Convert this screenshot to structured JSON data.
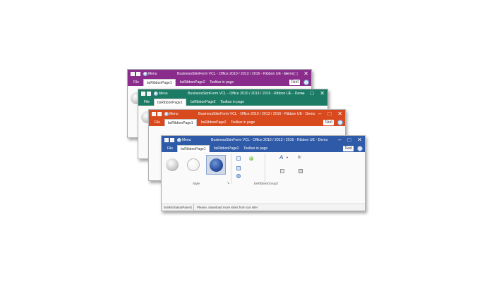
{
  "app": {
    "window_title": "BusinessSkinForm VCL - Office 2010 / 2013 / 2016 - Ribbon UE - Demo",
    "menu_label": "Menu",
    "text_button": "Text",
    "caption": {
      "minimize": "–",
      "maximize": "□",
      "close": "✕"
    }
  },
  "tabs": {
    "file": "File",
    "page1": "bsRibbonPage1",
    "page2": "bsRibbonPage2",
    "page3": "Toolbar in page"
  },
  "ribbon": {
    "style_group_label": "Style",
    "group2_label": "bsRibbonGroup2"
  },
  "statusbar": {
    "panel1": "bsSkinStatusPanel1",
    "panel2": "Please, download more skins from our site!"
  },
  "colors": {
    "purple": "#8a2c8c",
    "green": "#1b7b64",
    "orange": "#d8491e",
    "blue": "#2e5aa8",
    "selected_ball": "#2a4f9f"
  }
}
